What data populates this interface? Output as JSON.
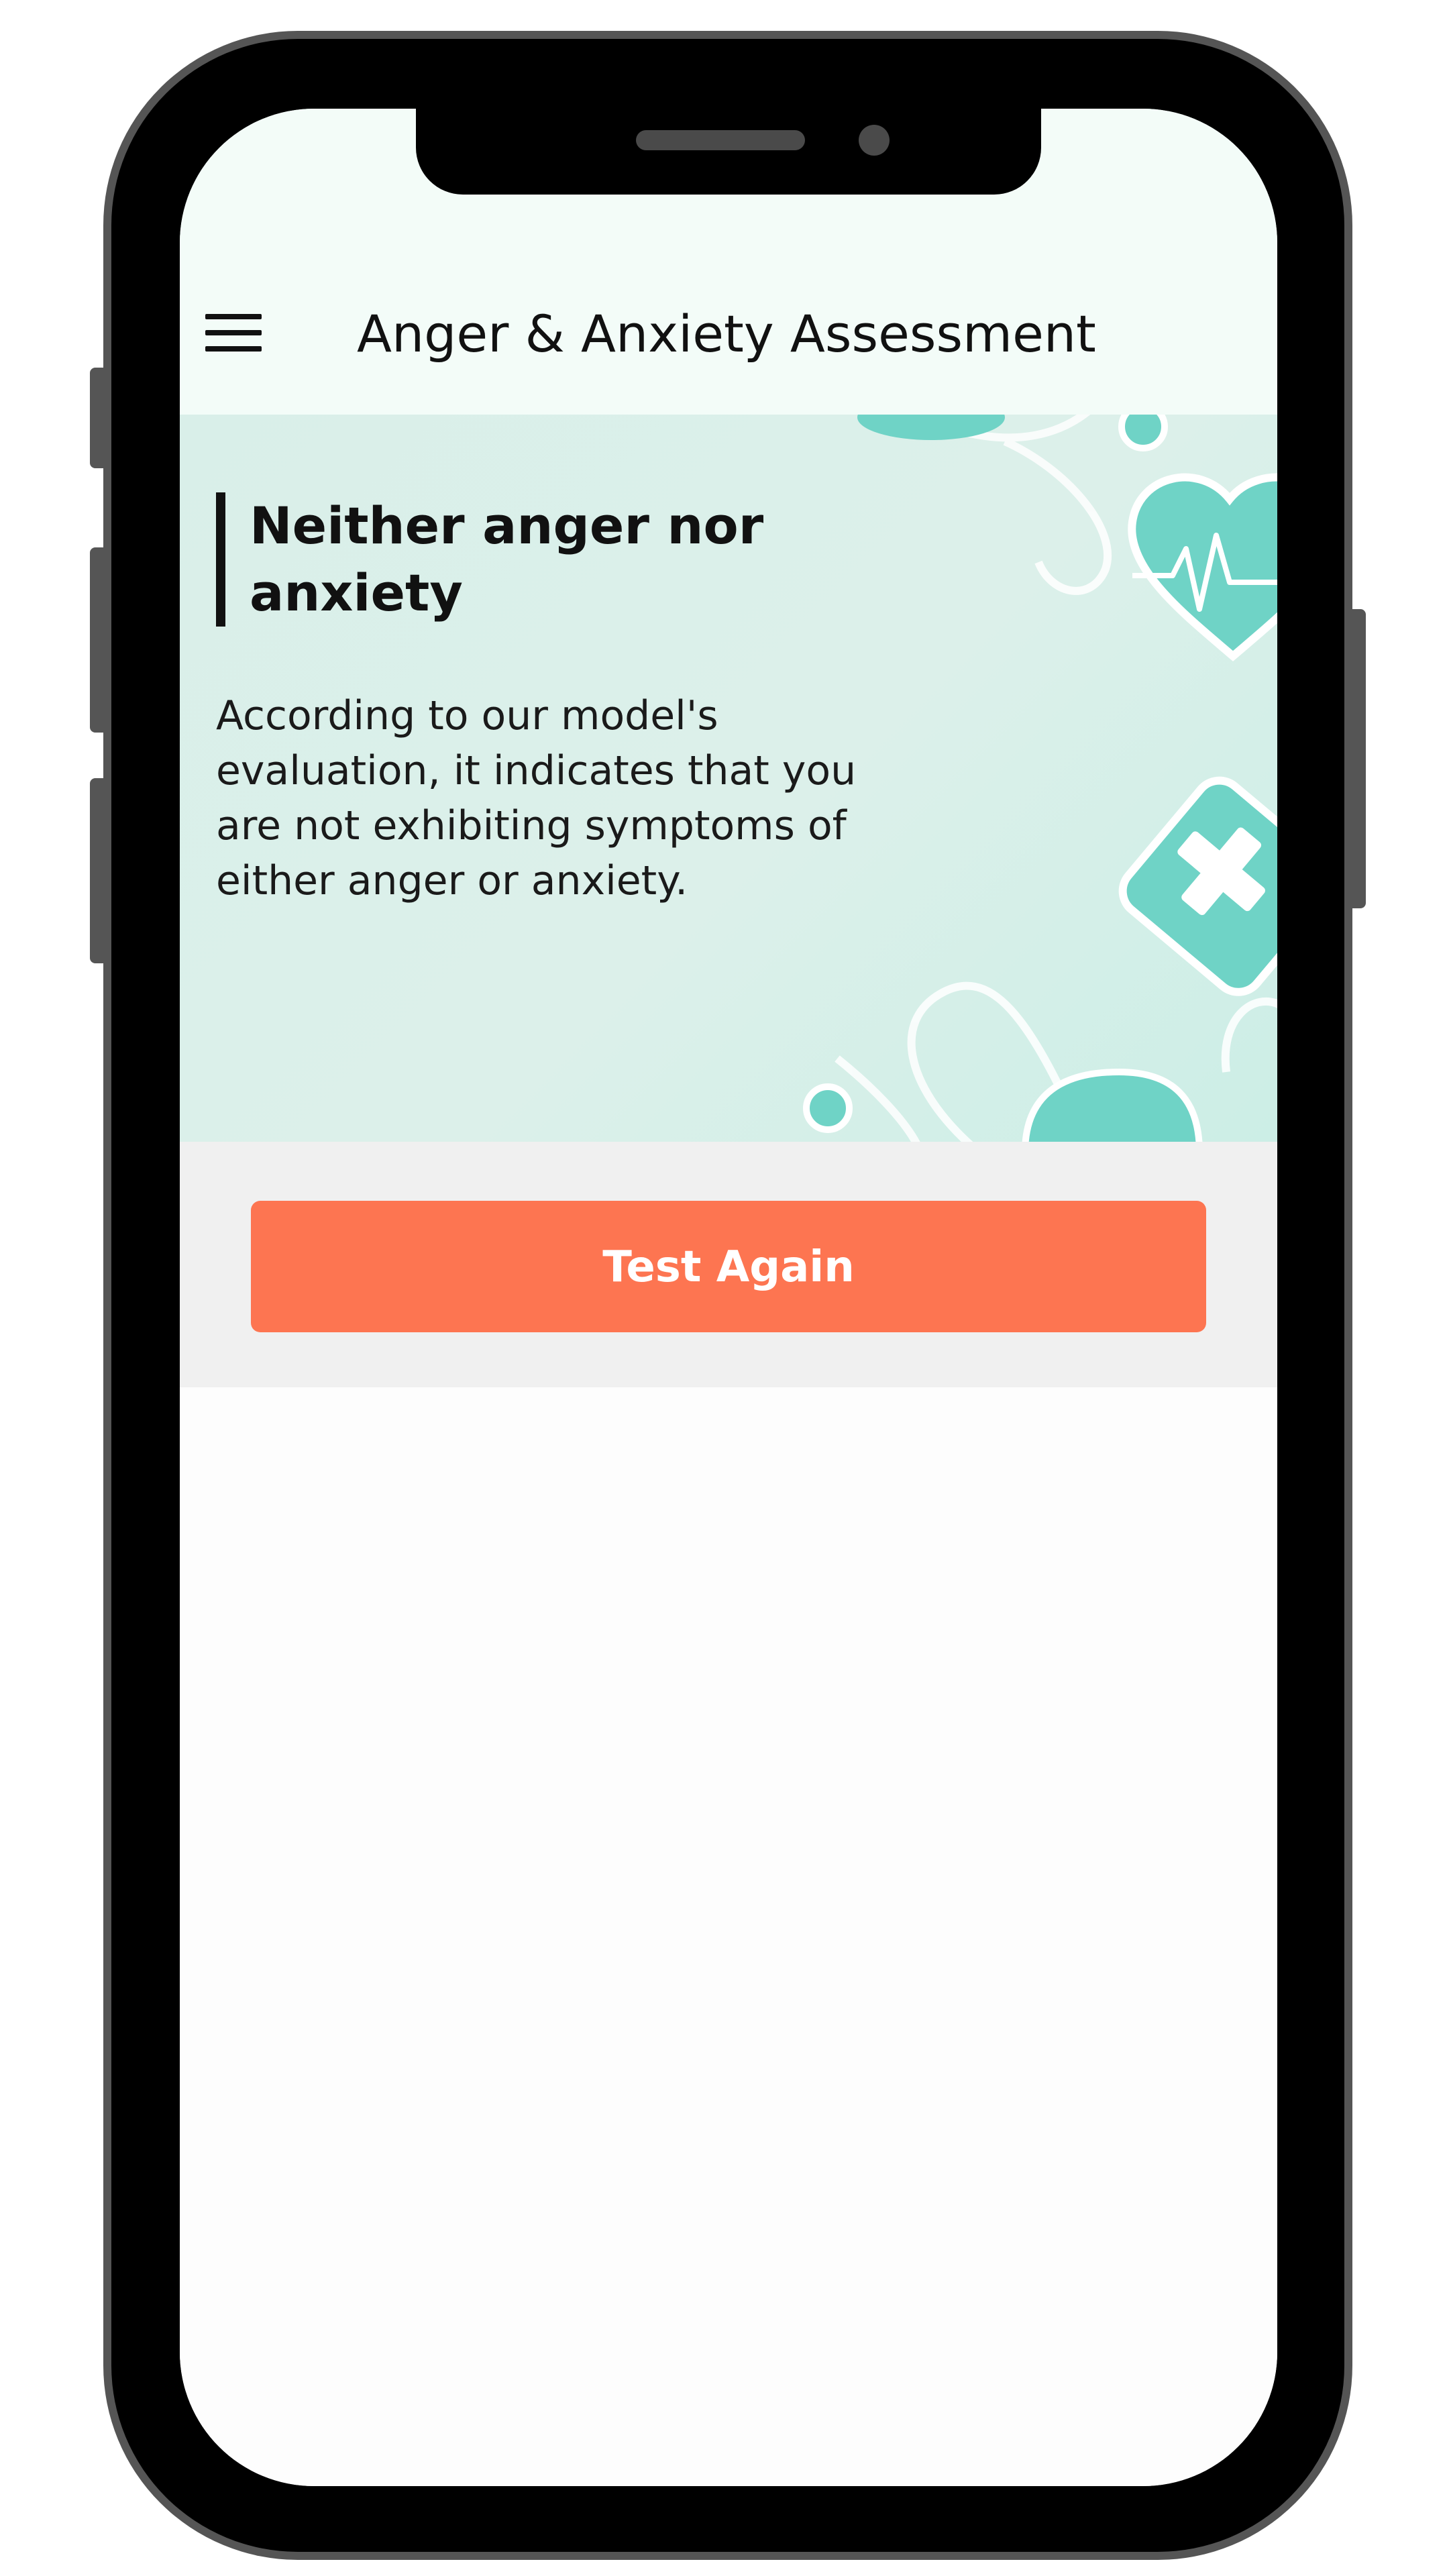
{
  "app_bar": {
    "title": "Anger & Anxiety Assessment",
    "menu_icon": "hamburger-menu-icon"
  },
  "result": {
    "heading": "Neither anger nor anxiety",
    "description": "According to our model's evaluation, it indicates that you are not exhibiting symptoms of either anger or anxiety."
  },
  "banner": {
    "decorations": [
      "stethoscope-icon",
      "heart-pulse-icon",
      "medical-bandage-icon"
    ],
    "accent_color": "#6fd3c6",
    "background_color": "#d9efe9"
  },
  "actions": {
    "test_again_label": "Test Again",
    "test_again_color": "#fd7551"
  }
}
